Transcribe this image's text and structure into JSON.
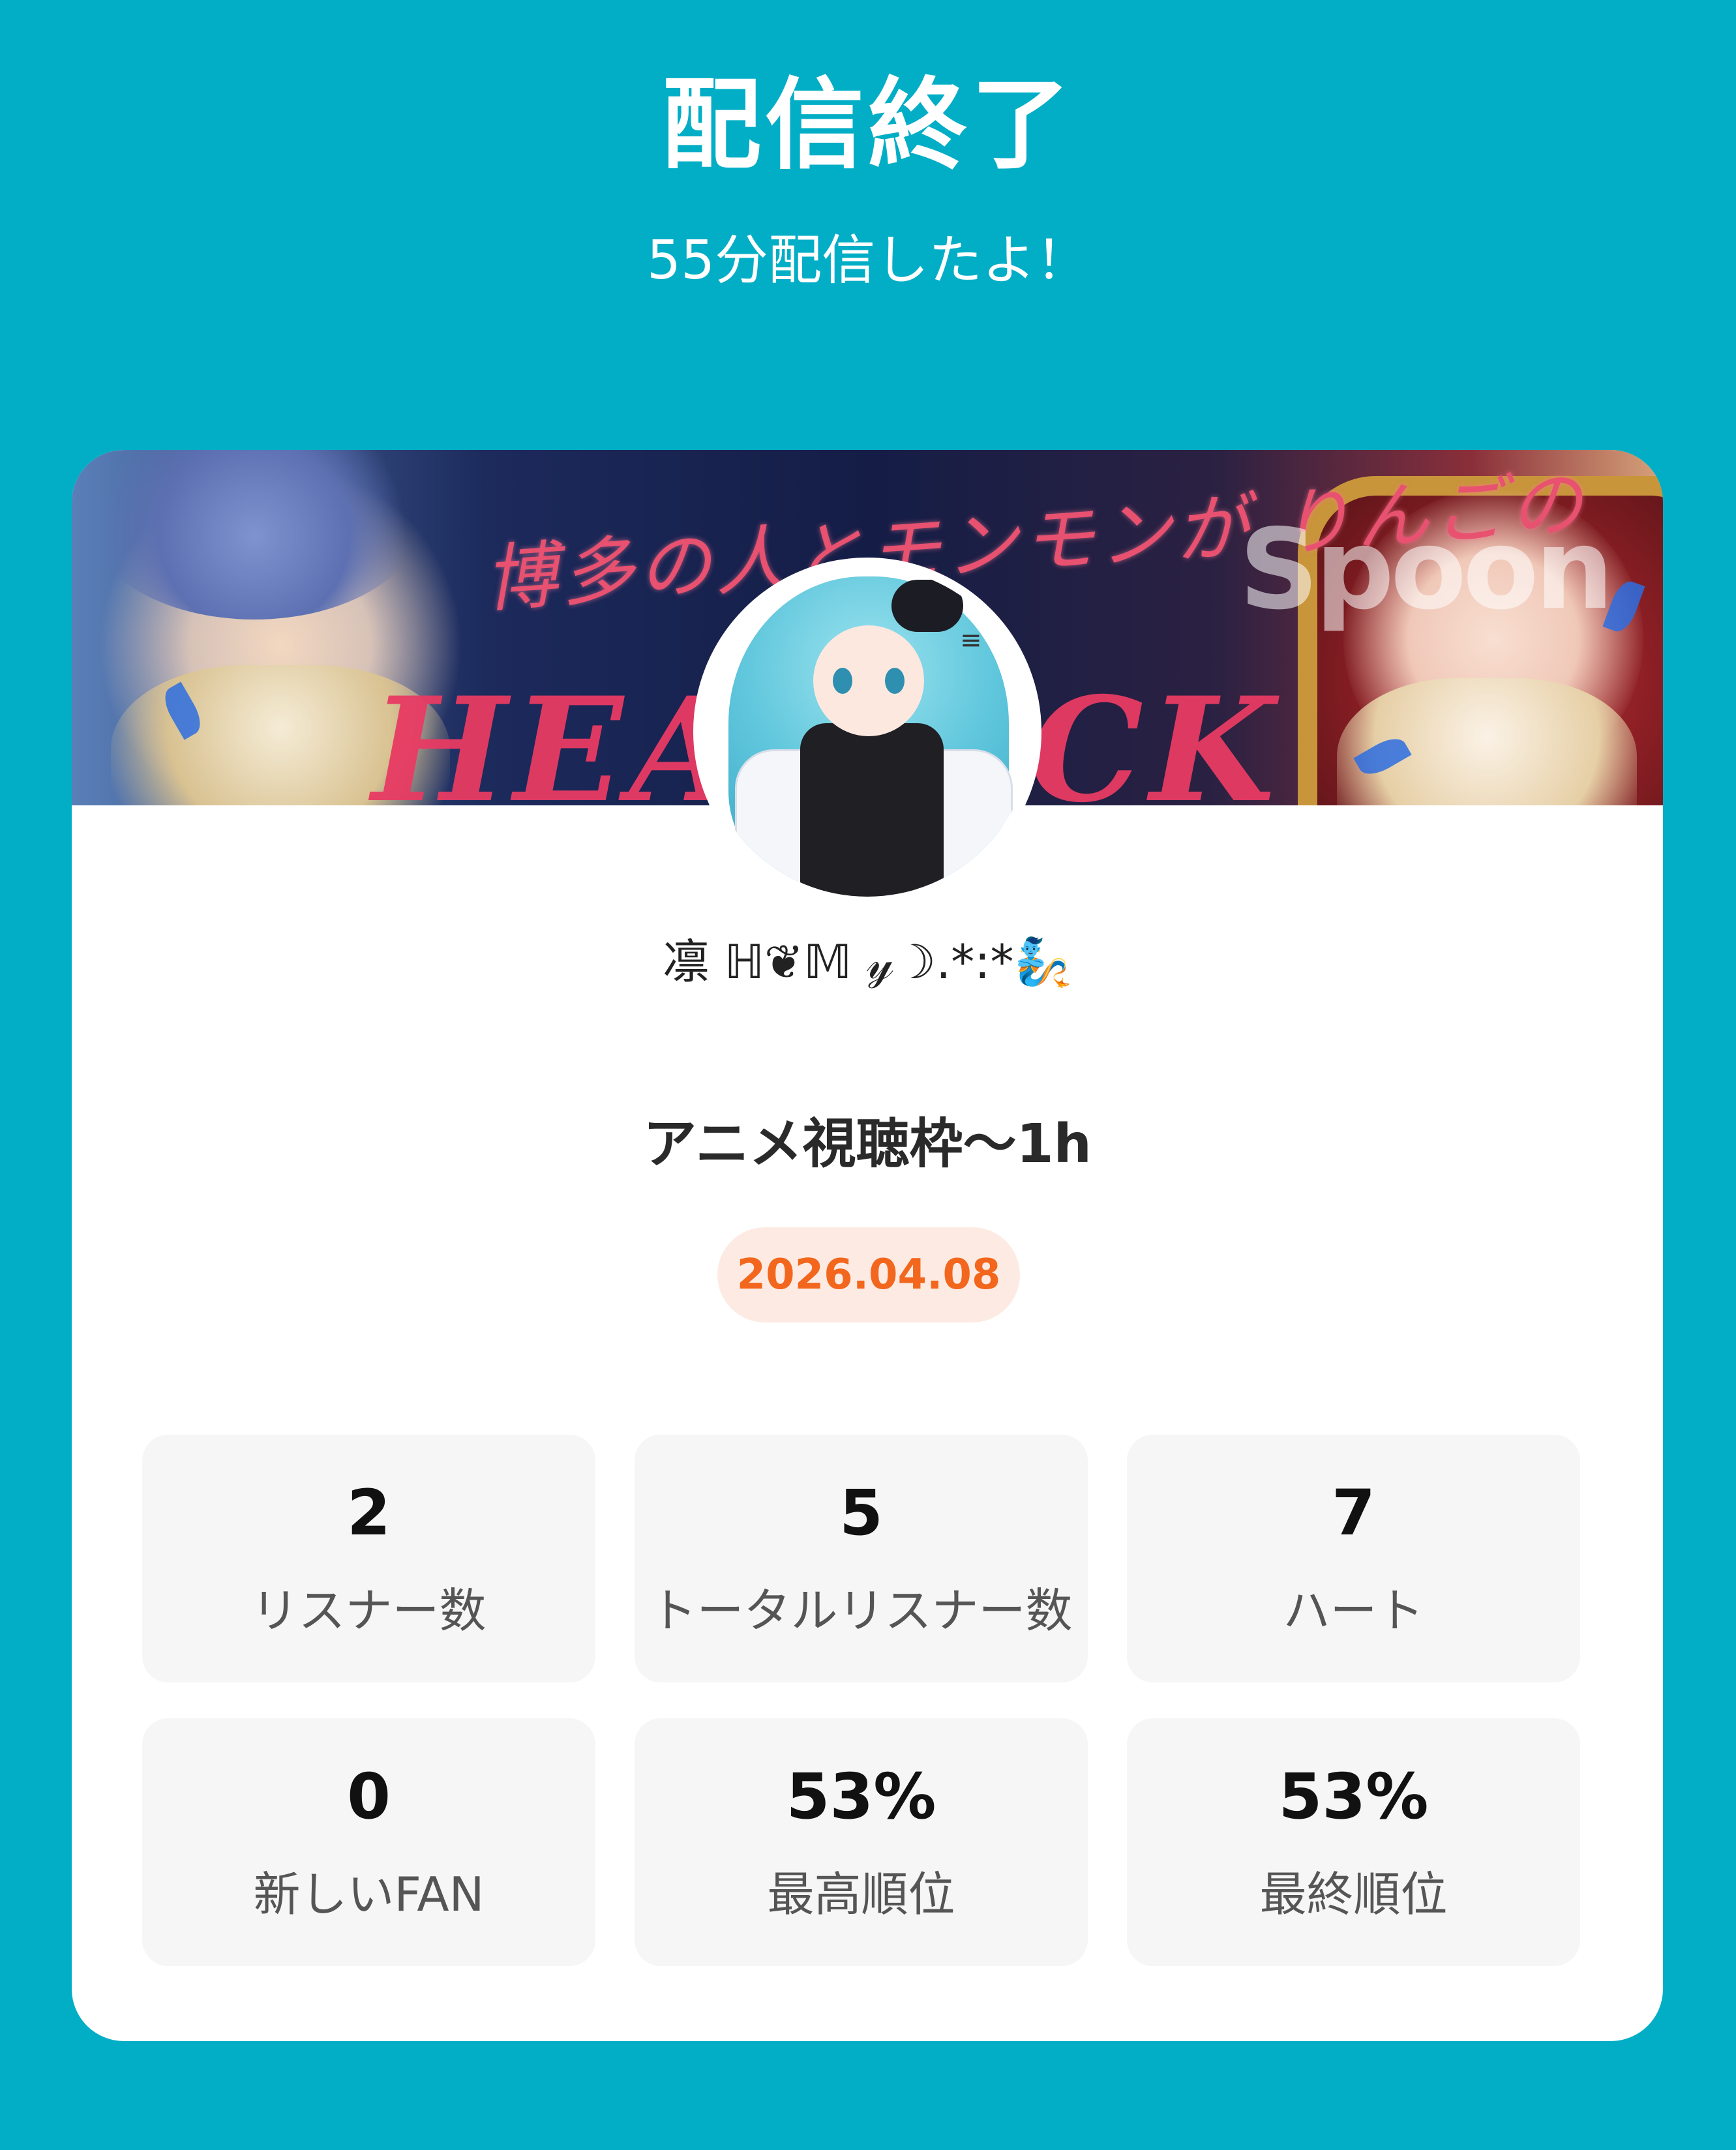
{
  "header": {
    "title": "配信終了",
    "subtitle": "55分配信したよ！"
  },
  "banner": {
    "title_jp": "博多の人とモンモンが りんごの",
    "title_en": "HEAL   ACK",
    "logo_text": "Spoon"
  },
  "user": {
    "name": "凛 ℍ❦𝕄 𝓎☽.*:*🧞"
  },
  "stream": {
    "title": "アニメ視聴枠～1h",
    "date": "2026.04.08"
  },
  "stats": [
    {
      "value": "2",
      "label": "リスナー数"
    },
    {
      "value": "5",
      "label": "トータルリスナー数"
    },
    {
      "value": "7",
      "label": "ハート"
    },
    {
      "value": "0",
      "label": "新しいFAN"
    },
    {
      "value": "53%",
      "label": "最高順位"
    },
    {
      "value": "53%",
      "label": "最終順位"
    }
  ],
  "colors": {
    "background": "#02aec6",
    "date_text": "#f2671d",
    "date_badge_bg": "#fdebe3"
  }
}
